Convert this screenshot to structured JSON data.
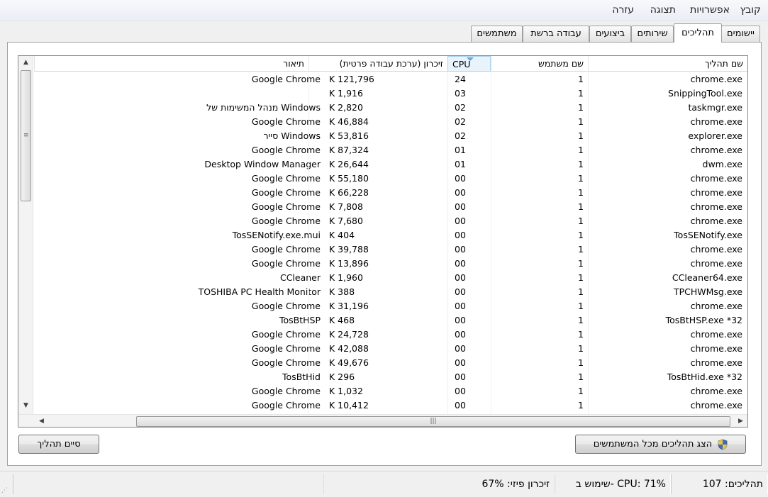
{
  "menu": [
    "קובץ",
    "אפשרויות",
    "תצוגה",
    "עזרה"
  ],
  "tabs": [
    "יישומים",
    "תהליכים",
    "שירותים",
    "ביצועים",
    "עבודה ברשת",
    "משתמשים"
  ],
  "active_tab": "תהליכים",
  "columns": {
    "name": "שם תהליך",
    "user": "שם משתמש",
    "cpu": "CPU",
    "memory": "זיכרון (ערכת עבודה פרטית)",
    "description": "תיאור"
  },
  "rows": [
    {
      "name": "chrome.exe",
      "user": "1",
      "cpu": "24",
      "mem": "K 121,796",
      "desc": "Google Chrome"
    },
    {
      "name": "SnippingTool.exe",
      "user": "1",
      "cpu": "03",
      "mem": "K 1,916",
      "desc": ""
    },
    {
      "name": "taskmgr.exe",
      "user": "1",
      "cpu": "02",
      "mem": "K 2,820",
      "desc": "מנהל המשימות של Windows"
    },
    {
      "name": "chrome.exe",
      "user": "1",
      "cpu": "02",
      "mem": "K 46,884",
      "desc": "Google Chrome"
    },
    {
      "name": "explorer.exe",
      "user": "1",
      "cpu": "02",
      "mem": "K 53,816",
      "desc": "סייר Windows"
    },
    {
      "name": "chrome.exe",
      "user": "1",
      "cpu": "01",
      "mem": "K 87,324",
      "desc": "Google Chrome"
    },
    {
      "name": "dwm.exe",
      "user": "1",
      "cpu": "01",
      "mem": "K 26,644",
      "desc": "Desktop Window Manager"
    },
    {
      "name": "chrome.exe",
      "user": "1",
      "cpu": "00",
      "mem": "K 55,180",
      "desc": "Google Chrome"
    },
    {
      "name": "chrome.exe",
      "user": "1",
      "cpu": "00",
      "mem": "K 66,228",
      "desc": "Google Chrome"
    },
    {
      "name": "chrome.exe",
      "user": "1",
      "cpu": "00",
      "mem": "K 7,808",
      "desc": "Google Chrome"
    },
    {
      "name": "chrome.exe",
      "user": "1",
      "cpu": "00",
      "mem": "K 7,680",
      "desc": "Google Chrome"
    },
    {
      "name": "TosSENotify.exe",
      "user": "1",
      "cpu": "00",
      "mem": "K 404",
      "desc": "TosSENotify.exe.mui"
    },
    {
      "name": "chrome.exe",
      "user": "1",
      "cpu": "00",
      "mem": "K 39,788",
      "desc": "Google Chrome"
    },
    {
      "name": "chrome.exe",
      "user": "1",
      "cpu": "00",
      "mem": "K 13,896",
      "desc": "Google Chrome"
    },
    {
      "name": "CCleaner64.exe",
      "user": "1",
      "cpu": "00",
      "mem": "K 1,960",
      "desc": "CCleaner"
    },
    {
      "name": "TPCHWMsg.exe",
      "user": "1",
      "cpu": "00",
      "mem": "K 388",
      "desc": "TOSHIBA PC Health Monitor"
    },
    {
      "name": "chrome.exe",
      "user": "1",
      "cpu": "00",
      "mem": "K 31,196",
      "desc": "Google Chrome"
    },
    {
      "name": "TosBtHSP.exe *32",
      "user": "1",
      "cpu": "00",
      "mem": "K 468",
      "desc": "TosBtHSP"
    },
    {
      "name": "chrome.exe",
      "user": "1",
      "cpu": "00",
      "mem": "K 24,728",
      "desc": "Google Chrome"
    },
    {
      "name": "chrome.exe",
      "user": "1",
      "cpu": "00",
      "mem": "K 42,088",
      "desc": "Google Chrome"
    },
    {
      "name": "chrome.exe",
      "user": "1",
      "cpu": "00",
      "mem": "K 49,676",
      "desc": "Google Chrome"
    },
    {
      "name": "TosBtHid.exe *32",
      "user": "1",
      "cpu": "00",
      "mem": "K 296",
      "desc": "TosBtHid"
    },
    {
      "name": "chrome.exe",
      "user": "1",
      "cpu": "00",
      "mem": "K 1,032",
      "desc": "Google Chrome"
    },
    {
      "name": "chrome.exe",
      "user": "1",
      "cpu": "00",
      "mem": "K 10,412",
      "desc": "Google Chrome"
    }
  ],
  "buttons": {
    "show_all": "הצג תהליכים מכל המשתמשים",
    "end_process": "סיים תהליך"
  },
  "status": {
    "processes": "תהליכים: 107",
    "cpu_usage": "שימוש ב- CPU: 71%",
    "physical_memory": "זיכרון פיזי: 67%"
  },
  "icons": {
    "shield": "uac-shield-icon",
    "sort": "sort-descending-icon"
  }
}
